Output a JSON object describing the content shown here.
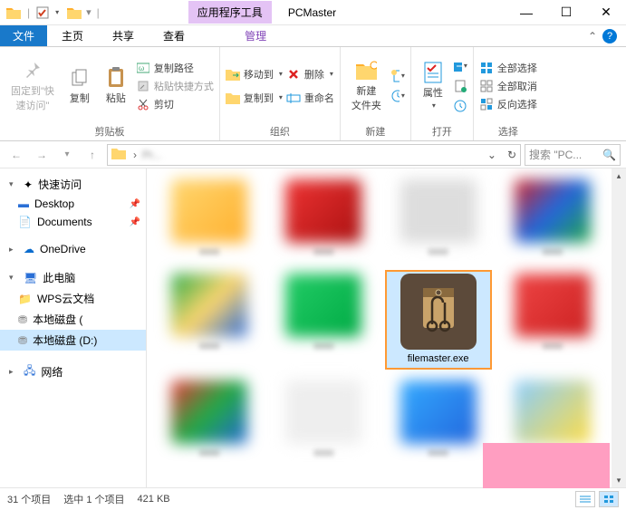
{
  "titlebar": {
    "tool_tab": "应用程序工具",
    "title": "PCMaster"
  },
  "tabs": {
    "file": "文件",
    "home": "主页",
    "share": "共享",
    "view": "查看",
    "manage": "管理"
  },
  "ribbon": {
    "pin": "固定到\"快\n速访问\"",
    "copy": "复制",
    "paste": "粘贴",
    "copy_path": "复制路径",
    "paste_shortcut": "粘贴快捷方式",
    "cut": "剪切",
    "clipboard_group": "剪贴板",
    "move_to": "移动到",
    "delete": "删除",
    "copy_to": "复制到",
    "rename": "重命名",
    "organize_group": "组织",
    "new_folder": "新建\n文件夹",
    "new_group": "新建",
    "properties": "属性",
    "open_group": "打开",
    "select_all": "全部选择",
    "select_none": "全部取消",
    "invert_selection": "反向选择",
    "select_group": "选择"
  },
  "addr": {
    "path_hint": "Pr...",
    "search_placeholder": "搜索 \"PC..."
  },
  "sidebar": {
    "quick_access": "快速访问",
    "desktop": "Desktop",
    "documents": "Documents",
    "onedrive": "OneDrive",
    "this_pc": "此电脑",
    "wps": "WPS云文档",
    "disk_c": "本地磁盘 (",
    "disk_d": "本地磁盘 (D:)",
    "network": "网络"
  },
  "content": {
    "selected_file": "filemaster.exe"
  },
  "status": {
    "count": "31 个项目",
    "selection": "选中 1 个项目",
    "size": "421 KB"
  }
}
